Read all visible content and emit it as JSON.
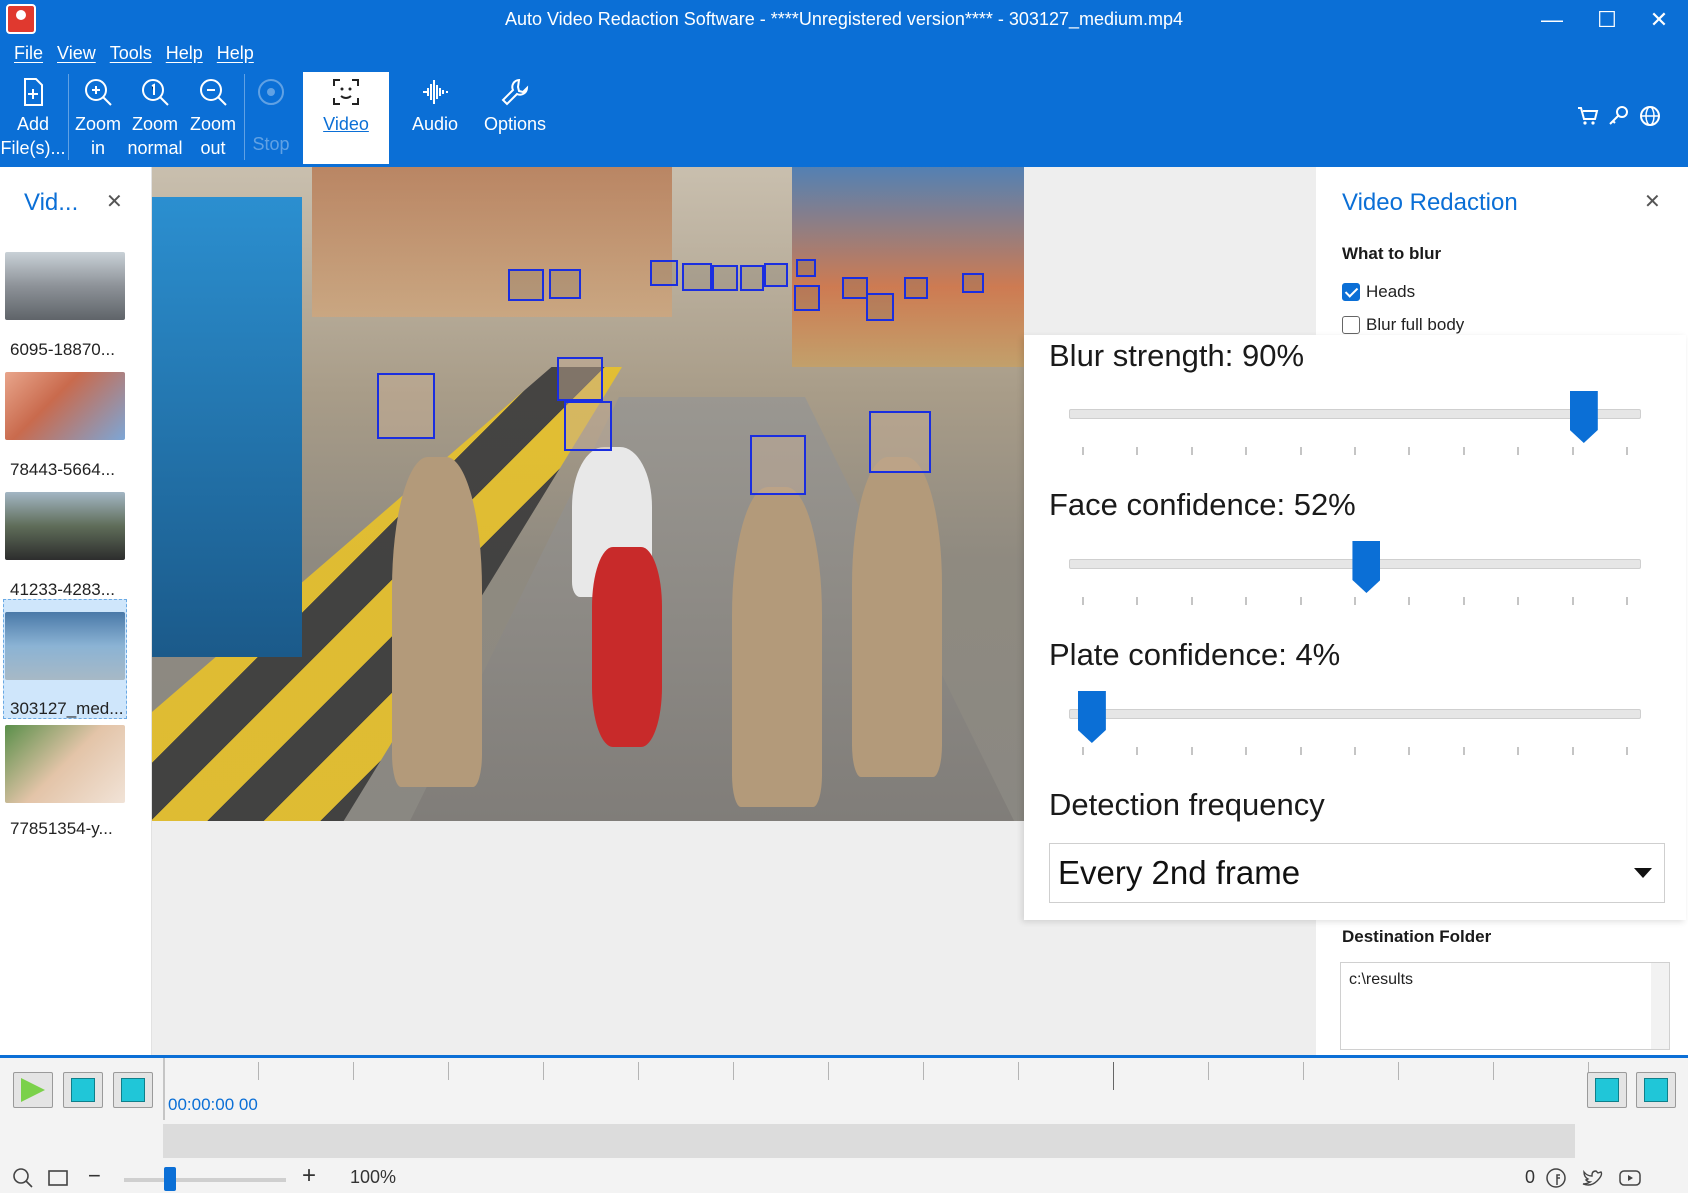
{
  "window": {
    "title": "Auto Video Redaction Software - ****Unregistered version**** - 303127_medium.mp4",
    "minimize": "—",
    "maximize": "☐",
    "close": "✕"
  },
  "menu": [
    "File",
    "View",
    "Tools",
    "Help",
    "Help"
  ],
  "toolbar": {
    "add_files": "Add\nFile(s)...",
    "zoom_in": "Zoom\nin",
    "zoom_normal": "Zoom\nnormal",
    "zoom_out": "Zoom\nout",
    "stop": "Stop",
    "video": "Video",
    "audio": "Audio",
    "options": "Options",
    "right_icons": [
      "cart-icon",
      "key-icon",
      "globe-icon"
    ]
  },
  "left_panel": {
    "title": "Vid...",
    "close": "✕",
    "files": [
      {
        "label": "6095-18870...",
        "selected": false
      },
      {
        "label": "78443-5664...",
        "selected": false
      },
      {
        "label": "41233-4283...",
        "selected": false
      },
      {
        "label": "303127_med...",
        "selected": true
      },
      {
        "label": "77851354-y...",
        "selected": false
      }
    ]
  },
  "right_panel": {
    "title": "Video Redaction",
    "close": "✕",
    "what_to_blur": "What to blur",
    "heads_label": "Heads",
    "heads_checked": true,
    "blur_full_body_label": "Blur full body",
    "blur_full_body_checked": false,
    "destination_heading": "Destination Folder",
    "destination_value": "c:\\results"
  },
  "settings": {
    "blur_strength_label": "Blur strength: 90%",
    "blur_strength_value": 0.9,
    "face_confidence_label": "Face confidence: 52%",
    "face_confidence_value": 0.52,
    "plate_confidence_label": "Plate confidence: 4%",
    "plate_confidence_value": 0.04,
    "detection_frequency_label": "Detection frequency",
    "detection_frequency_value": "Every 2nd frame"
  },
  "timeline": {
    "time": "00:00:00 00",
    "zoom_level": "100%",
    "zoom_fraction": 0.3,
    "right_counter": "0"
  },
  "colors": {
    "accent": "#0b6fd6",
    "detection_box": "#1a2ee0"
  }
}
